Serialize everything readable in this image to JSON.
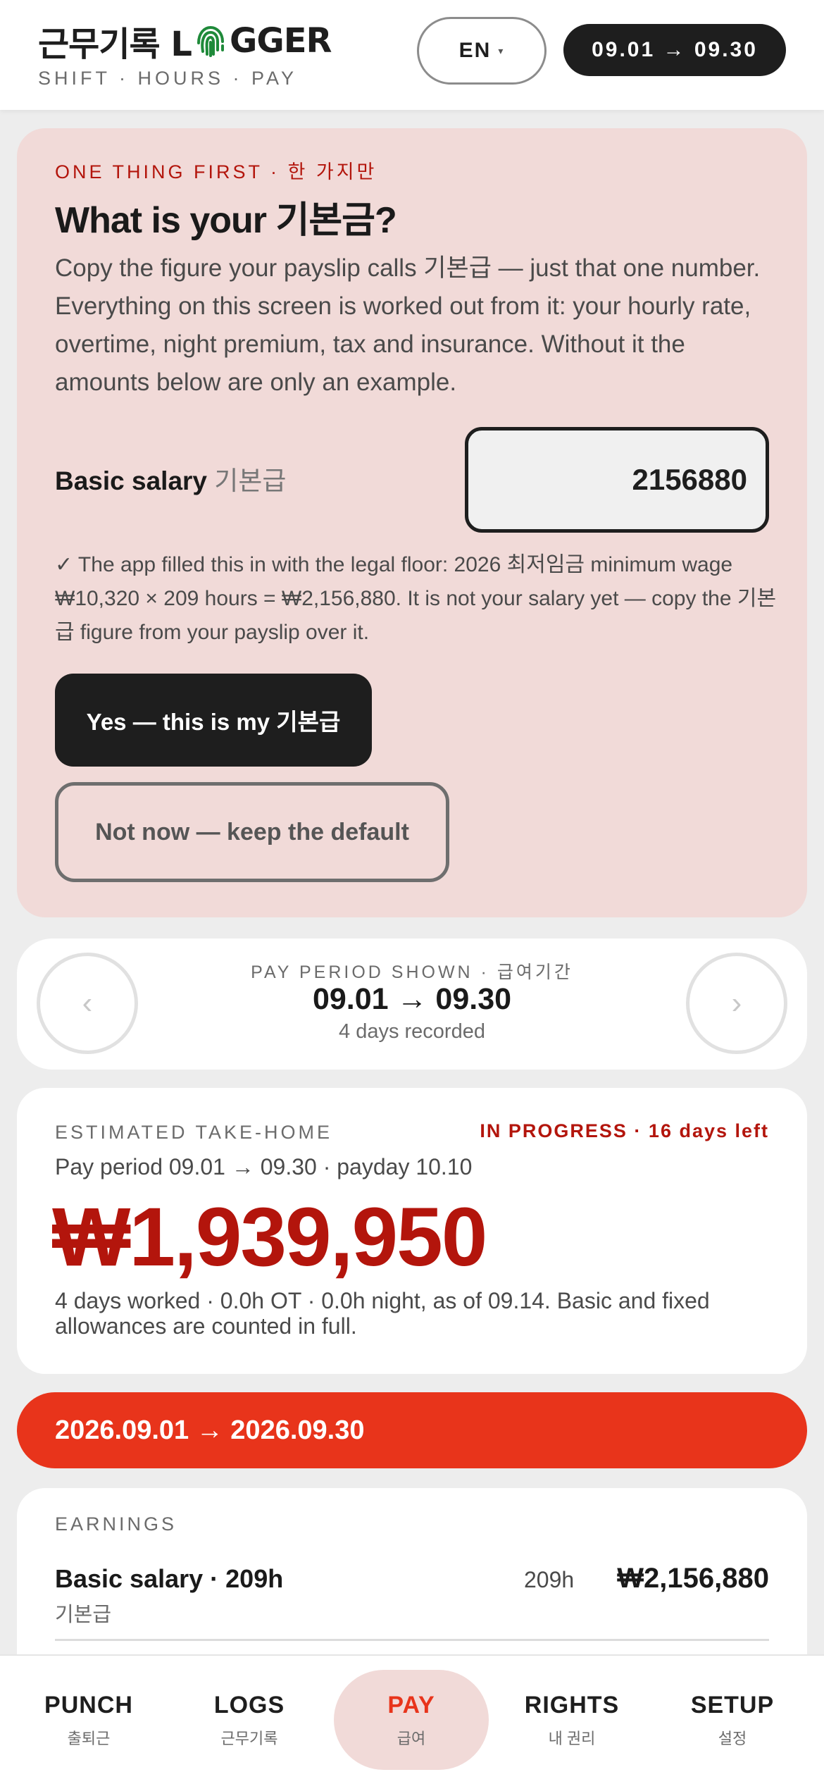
{
  "header": {
    "brand_title_pre": "근무기록 L",
    "brand_title_post": "GGER",
    "brand_subtitle": "SHIFT · HOURS · PAY",
    "lang_label": "EN",
    "lang_caret": "▾",
    "period_pill": "09.01 → 09.30"
  },
  "onboarding": {
    "eyebrow": "ONE THING FIRST · 한 가지만",
    "title": "What is your 기본금?",
    "body": "Copy the figure your payslip calls 기본급 — just that one number. Everything on this screen is worked out from it: your hourly rate, overtime, night premium, tax and insurance. Without it the amounts below are only an example.",
    "salary_label": "Basic salary",
    "salary_label_ko": "기본급",
    "salary_value": "2156880",
    "note": "✓ The app filled this in with the legal floor: 2026 최저임금 minimum wage ₩10,320 × 209 hours = ₩2,156,880. It is not your salary yet — copy the 기본급 figure from your payslip over it.",
    "primary_button": "Yes — this is my 기본급",
    "secondary_button": "Not now — keep the default"
  },
  "period_nav": {
    "label": "PAY PERIOD SHOWN · 급여기간",
    "range": "09.01 → 09.30",
    "days": "4 days recorded",
    "prev": "‹",
    "next": "›"
  },
  "takehome": {
    "label": "ESTIMATED TAKE-HOME",
    "status": "IN PROGRESS · 16 days left",
    "period": "Pay period 09.01 → 09.30 · payday 10.10",
    "amount": "₩1,939,950",
    "note": "4 days worked · 0.0h OT · 0.0h night, as of 09.14. Basic and fixed allowances are counted in full."
  },
  "banner": {
    "range": "2026.09.01 → 2026.09.30"
  },
  "earnings": {
    "label": "EARNINGS",
    "row_title": "Basic salary · 209h",
    "row_sub": "기본급",
    "row_hours": "209h",
    "row_amount": "₩2,156,880"
  },
  "bottom_nav": {
    "items": [
      {
        "label": "PUNCH",
        "sub": "출퇴근"
      },
      {
        "label": "LOGS",
        "sub": "근무기록"
      },
      {
        "label": "PAY",
        "sub": "급여"
      },
      {
        "label": "RIGHTS",
        "sub": "내 권리"
      },
      {
        "label": "SETUP",
        "sub": "설정"
      }
    ]
  },
  "colors": {
    "accent_red": "#e8341b",
    "dark_red": "#b3150c",
    "onboard_bg": "#f1dad8",
    "logo_green": "#1f8a3a",
    "dark": "#1e1e1e"
  },
  "icons": {
    "logo": "fingerprint-icon",
    "prev": "chevron-left-icon",
    "next": "chevron-right-icon"
  }
}
